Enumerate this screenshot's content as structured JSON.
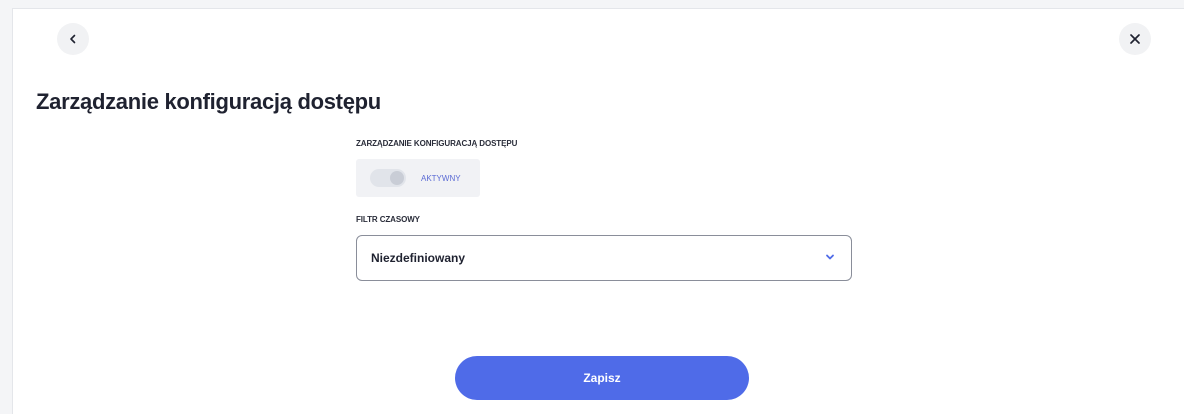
{
  "header": {
    "title": "Zarządzanie konfiguracją dostępu"
  },
  "access_config": {
    "label": "ZARZĄDZANIE KONFIGURACJĄ DOSTĘPU",
    "toggle_status": "AKTYWNY"
  },
  "time_filter": {
    "label": "FILTR CZASOWY",
    "selected": "Niezdefiniowany"
  },
  "actions": {
    "save_label": "Zapisz"
  },
  "colors": {
    "accent": "#4f6be8",
    "status_text": "#5a6ad4"
  },
  "icons": {
    "back": "chevron-left-icon",
    "close": "close-icon",
    "dropdown": "chevron-down-icon"
  }
}
